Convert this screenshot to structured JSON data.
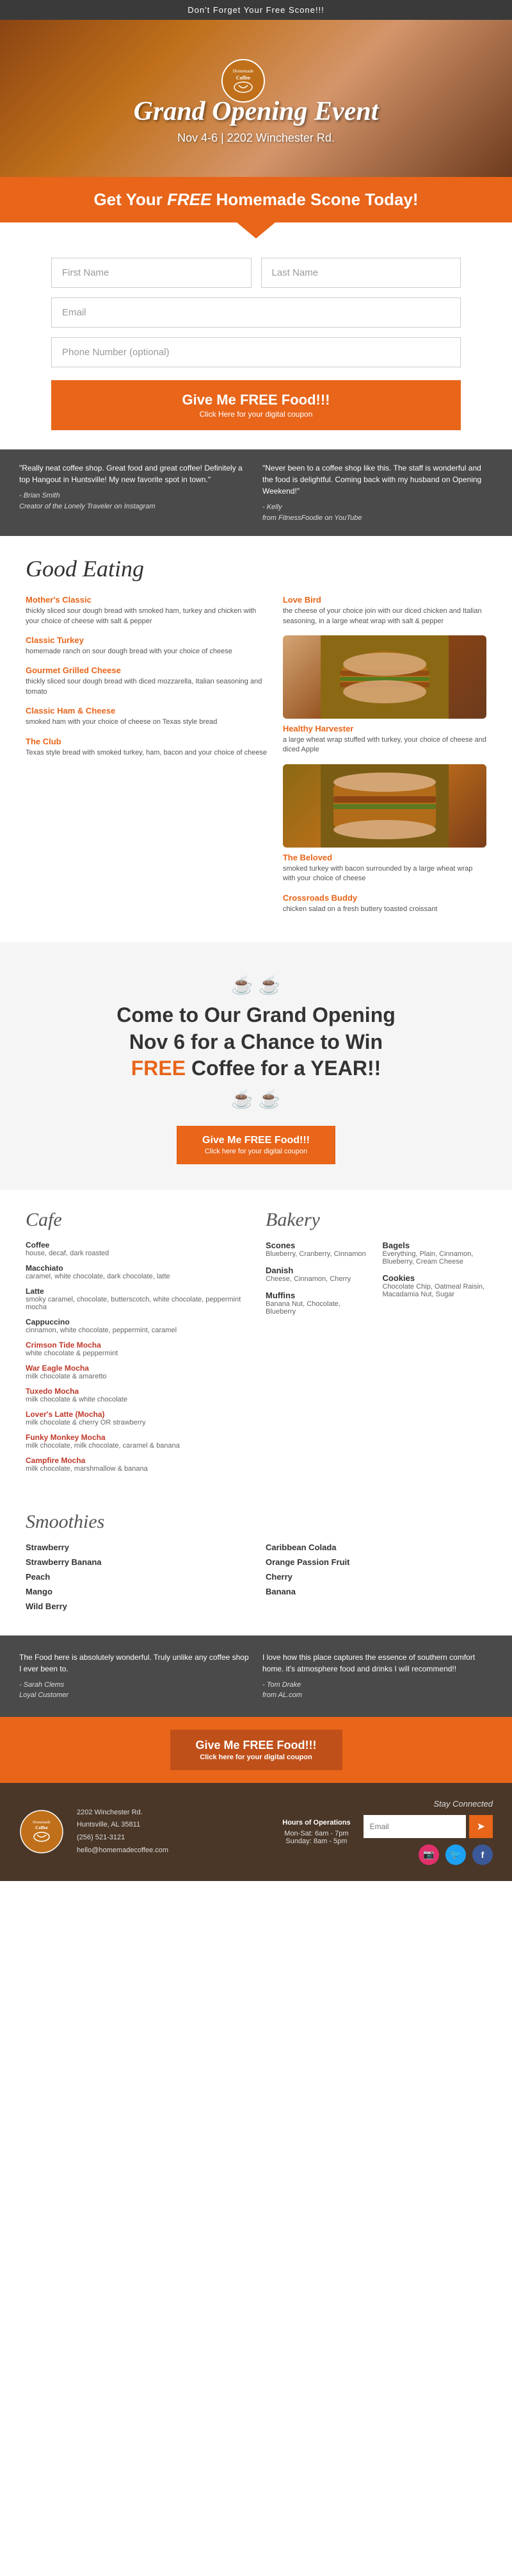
{
  "topBar": {
    "text": "Don't Forget Your Free Scone!!!"
  },
  "hero": {
    "title": "Grand Opening Event",
    "subtitle": "Nov 4-6 | 2202 Winchester Rd."
  },
  "freeBanner": {
    "text_pre": "Get Your ",
    "free": "FREE",
    "text_post": " Homemade Scone Today!"
  },
  "form": {
    "firstName": "First Name",
    "lastName": "Last Name",
    "email": "Email",
    "phone": "Phone Number (optional)",
    "submitBtn": "Give Me FREE Food!!!",
    "submitSub": "Click Here for your digital coupon"
  },
  "testimonials": [
    {
      "quote": "\"Really neat coffee shop. Great food and great coffee! Definitely a top Hangout in Huntsville! My new favorite spot in town.\"",
      "author": "- Brian Smith",
      "role": "Creator of the Lonely Traveler on Instagram"
    },
    {
      "quote": "\"Never been to a coffee shop like this. The staff is wonderful and the food is delightful. Coming back with my husband on Opening Weekend!\"",
      "author": "- Kelly",
      "role": "from FitnessFoodie on YouTube"
    }
  ],
  "goodEating": {
    "title": "Good Eating",
    "items": [
      {
        "name": "Mother's Classic",
        "desc": "thickly sliced sour dough bread with smoked ham, turkey and chicken with your choice of cheese with salt & pepper"
      },
      {
        "name": "Classic Turkey",
        "desc": "homemade ranch on sour dough bread with your choice of cheese"
      },
      {
        "name": "Gourmet Grilled Cheese",
        "desc": "thickly sliced sour dough bread with diced mozzarella, Italian seasoning and tomato"
      },
      {
        "name": "Classic Ham & Cheese",
        "desc": "smoked ham with your choice of cheese on Texas style bread"
      },
      {
        "name": "The Club",
        "desc": "Texas style bread with smoked turkey, ham, bacon and your choice of cheese"
      },
      {
        "name": "Love Bird",
        "desc": "the cheese of your choice join with our diced chicken and Italian seasoning, in a large wheat wrap with salt & pepper"
      },
      {
        "name": "Healthy Harvester",
        "desc": "a large wheat wrap stuffed with turkey, your choice of cheese and diced Apple"
      },
      {
        "name": "The Beloved",
        "desc": "smoked turkey with bacon surrounded by a large wheat wrap with your choice of cheese"
      },
      {
        "name": "Crossroads Buddy",
        "desc": "chicken salad on a fresh buttery toasted croissant"
      }
    ]
  },
  "winBanner": {
    "line1": "Come to Our Grand Opening",
    "line2": "Nov 6 for a Chance to Win",
    "free": "FREE",
    "line3": "Coffee for a YEAR!!",
    "btnLabel": "Give Me FREE Food!!!",
    "btnSub": "Click here for your digital coupon"
  },
  "cafe": {
    "title": "Cafe",
    "items": [
      {
        "name": "Coffee",
        "desc": "house, decaf, dark roasted",
        "highlight": false
      },
      {
        "name": "Macchiato",
        "desc": "caramel, white chocolate, dark chocolate, latte",
        "highlight": false
      },
      {
        "name": "Latte",
        "desc": "smoky caramel, chocolate, butterscotch, white chocolate, peppermint mocha",
        "highlight": false
      },
      {
        "name": "Cappuccino",
        "desc": "cinnamon, white chocolate, peppermint, caramel",
        "highlight": false
      },
      {
        "name": "Crimson Tide Mocha",
        "desc": "white chocolate & peppermint",
        "highlight": true
      },
      {
        "name": "War Eagle Mocha",
        "desc": "milk chocolate & amaretto",
        "highlight": true
      },
      {
        "name": "Tuxedo Mocha",
        "desc": "milk chocolate & white chocolate",
        "highlight": true
      },
      {
        "name": "Lover's Latte (Mocha)",
        "desc": "milk chocolate & cherry OR strawberry",
        "highlight": true
      },
      {
        "name": "Funky Monkey Mocha",
        "desc": "milk chocolate, milk chocolate, caramel & banana",
        "highlight": true
      },
      {
        "name": "Campfire Mocha",
        "desc": "milk chocolate, marshmallow & banana",
        "highlight": true
      }
    ]
  },
  "bakery": {
    "title": "Bakery",
    "col1": [
      {
        "name": "Scones",
        "desc": "Blueberry, Cranberry, Cinnamon"
      },
      {
        "name": "Danish",
        "desc": "Cheese, Cinnamon, Cherry"
      },
      {
        "name": "Muffins",
        "desc": "Banana Nut, Chocolate, Blueberry"
      }
    ],
    "col2": [
      {
        "name": "Bagels",
        "desc": "Everything, Plain, Cinnamon, Blueberry, Cream Cheese"
      },
      {
        "name": "Cookies",
        "desc": "Chocolate Chip, Oatmeal Raisin, Macadamia Nut, Sugar"
      }
    ]
  },
  "smoothies": {
    "title": "Smoothies",
    "col1": [
      {
        "name": "Strawberry",
        "desc": ""
      },
      {
        "name": "Strawberry Banana",
        "desc": ""
      },
      {
        "name": "Peach",
        "desc": ""
      },
      {
        "name": "Mango",
        "desc": ""
      },
      {
        "name": "Wild Berry",
        "desc": ""
      }
    ],
    "col2": [
      {
        "name": "Caribbean Colada",
        "desc": ""
      },
      {
        "name": "Orange Passion Fruit",
        "desc": ""
      },
      {
        "name": "Cherry",
        "desc": ""
      },
      {
        "name": "Banana",
        "desc": ""
      }
    ]
  },
  "bottomTestimonials": [
    {
      "quote": "The Food here is absolutely wonderful. Truly unlike any coffee shop I ever been to.",
      "author": "- Sarah Clems",
      "role": "Loyal Customer"
    },
    {
      "quote": "I love how this place captures the essence of southern comfort home. it's atmosphere food and drinks I will recommend!!",
      "author": "- Tom Drake",
      "role": "from AL.com"
    }
  ],
  "finalCta": {
    "btnLabel": "Give Me FREE Food!!!",
    "btnSub": "Click here for your digital coupon"
  },
  "footer": {
    "address": "2202 Winchester Rd.",
    "city": "Huntsville, AL 35811",
    "phone": "(256) 521-3121",
    "email": "hello@homemadecoffee.com",
    "hoursTitle": "Hours of Operations",
    "hours1": "Mon-Sat: 6am - 7pm",
    "hours2": "Sunday: 8am - 5pm",
    "emailPlaceholder": "Email",
    "emailBtn": "➤",
    "socialInstagram": "📷",
    "socialTwitter": "🐦",
    "socialFacebook": "f",
    "tagline": "Stay Connected"
  }
}
